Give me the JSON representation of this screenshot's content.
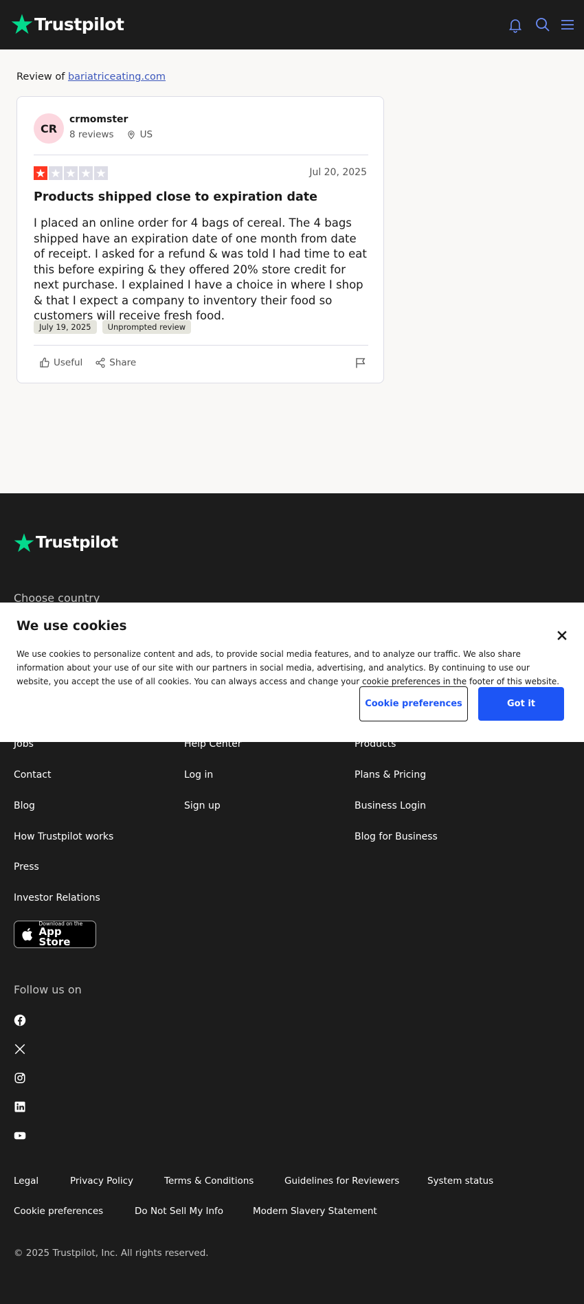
{
  "brand": {
    "name": "Trustpilot",
    "green": "#04da8d",
    "blue": "#1d55f5"
  },
  "header": {
    "icons": [
      "bell-icon",
      "search-icon",
      "menu-icon"
    ]
  },
  "review": {
    "prefix": "Review of",
    "company": "bariatriceating.com",
    "avatar_initials": "CR",
    "username": "crmomster",
    "review_count": "8 reviews",
    "country": "US",
    "rating": 1,
    "date": "Jul 20, 2025",
    "title": "Products shipped close to expiration date",
    "body": "I placed an online order for 4 bags of cereal. The 4 bags shipped have an expiration date of one month from date of receipt. I asked for a refund & was told I had time to eat this before expiring & they offered 20% store credit for next purchase. I explained I have a choice in where I shop & that I expect a company to inventory their food so customers will receive fresh food.",
    "experience_date": "July 19, 2025",
    "badge": "Unprompted review",
    "useful_label": "Useful",
    "share_label": "Share"
  },
  "footer": {
    "choose_country": "Choose country",
    "col1": [
      "Jobs",
      "Contact",
      "Blog",
      "How Trustpilot works",
      "Press",
      "Investor Relations"
    ],
    "col2": [
      "Help Center",
      "Log in",
      "Sign up"
    ],
    "col3": [
      "Products",
      "Plans & Pricing",
      "Business Login",
      "Blog for Business"
    ],
    "appstore_small": "Download on the",
    "appstore_big": "App Store",
    "follow": "Follow us on",
    "social": [
      "facebook-icon",
      "x-icon",
      "instagram-icon",
      "linkedin-icon",
      "youtube-icon"
    ],
    "legal_row1": [
      "Legal",
      "Privacy Policy",
      "Terms & Conditions",
      "Guidelines for Reviewers",
      "System status"
    ],
    "legal_row2": [
      "Cookie preferences",
      "Do Not Sell My Info",
      "Modern Slavery Statement"
    ],
    "copyright": "© 2025 Trustpilot, Inc. All rights reserved."
  },
  "cookie": {
    "title": "We use cookies",
    "text": "We use cookies to personalize content and ads, to provide social media features, and to analyze our traffic. We also share information about your use of our site with our partners in social media, advertising, and analytics. By continuing to use our website, you accept the use of all cookies. You can always access and change your cookie preferences in the footer of this website.",
    "preferences_label": "Cookie preferences",
    "accept_label": "Got it"
  }
}
